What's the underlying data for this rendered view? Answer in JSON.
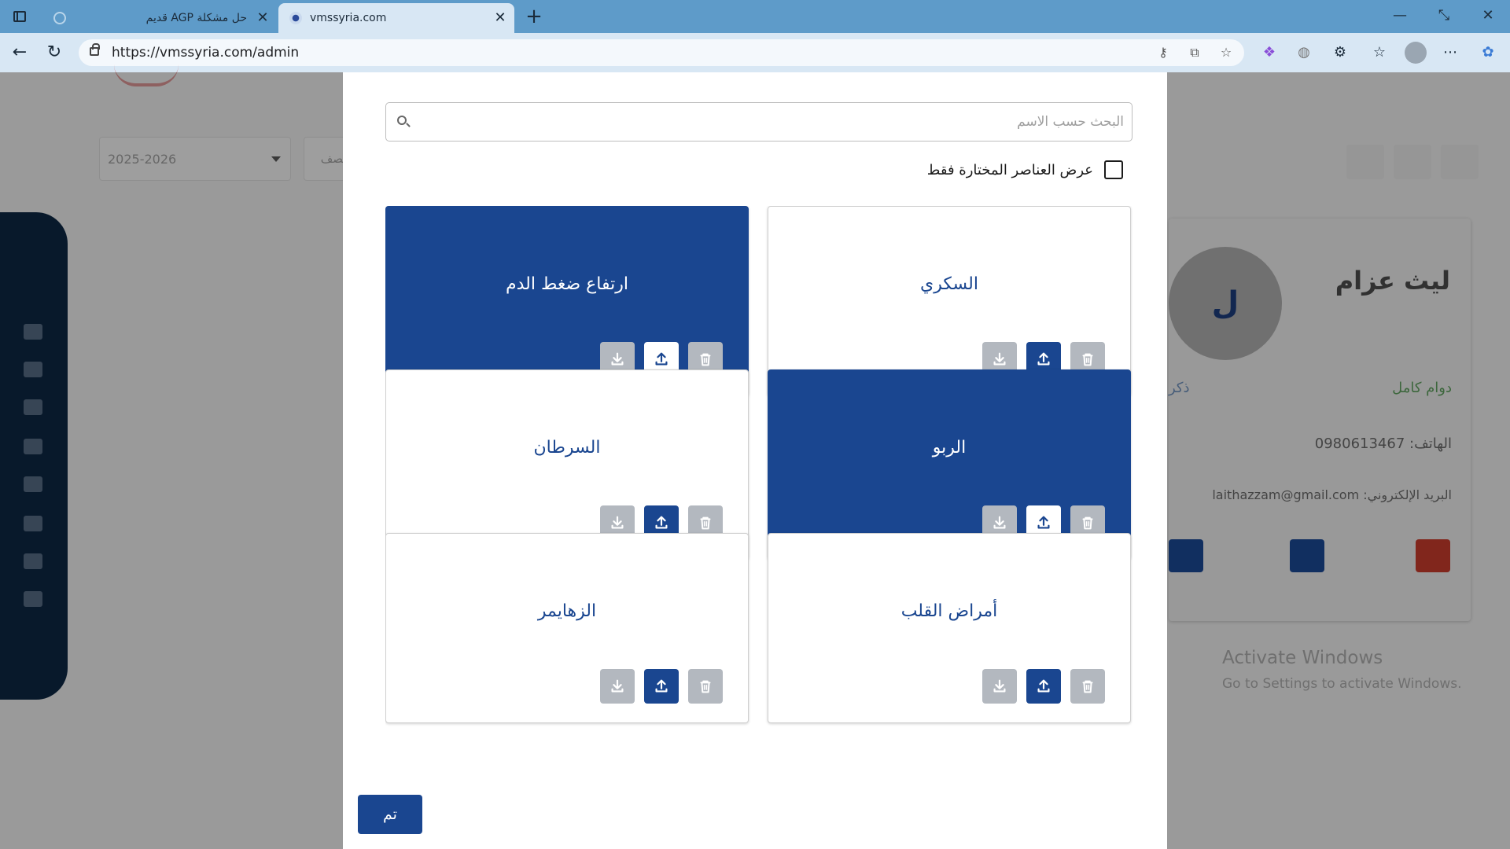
{
  "browser": {
    "tabs": [
      {
        "title": "حل مشكلة AGP قديم",
        "active": false
      },
      {
        "title": "vmssyria.com",
        "active": true
      }
    ],
    "url": "https://vmssyria.com/admin",
    "icons": [
      "sidebar-toggle-icon",
      "close-icon",
      "new-tab-icon",
      "minimize-icon",
      "restore-icon",
      "back-icon",
      "reload-icon",
      "site-info-icon",
      "key-icon",
      "open-in-app-icon",
      "star-icon",
      "copilot-icon",
      "globe-icon",
      "extensions-icon",
      "favorites-icon",
      "profile-icon",
      "more-icon",
      "edge-copilot-icon"
    ]
  },
  "background": {
    "year_select": "2025-2026",
    "class_select": "الصف",
    "profile": {
      "initial": "ل",
      "name": "ليث عزام",
      "status": "دوام كامل",
      "gender": "ذكر",
      "phone": "الهاتف: 0980613467",
      "email": "البريد الإلكتروني: laithazzam@gmail.com"
    },
    "watermark_title": "Activate Windows",
    "watermark_sub": "Go to Settings to activate Windows."
  },
  "modal": {
    "search_placeholder": "البحث حسب الاسم",
    "search_value": "",
    "filter_label": "عرض العناصر المختارة فقط",
    "filter_checked": false,
    "items": [
      {
        "name": "السكري",
        "selected": false
      },
      {
        "name": "ارتفاع ضغط الدم",
        "selected": true
      },
      {
        "name": "الربو",
        "selected": true
      },
      {
        "name": "السرطان",
        "selected": false
      },
      {
        "name": "أمراض القلب",
        "selected": false
      },
      {
        "name": "الزهايمر",
        "selected": false
      }
    ],
    "done_label": "تم"
  },
  "colors": {
    "primary": "#1a4690",
    "disabled_button": "#b3b8bf",
    "tabbar": "#5e9bc9",
    "addressbar": "#d8e7f4"
  }
}
